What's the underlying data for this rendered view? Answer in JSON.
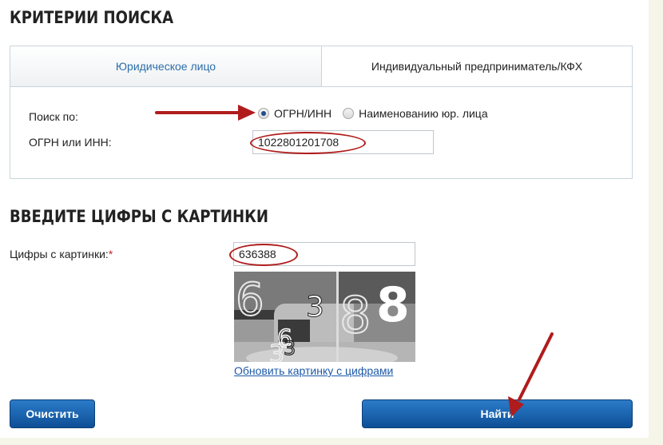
{
  "search_criteria": {
    "heading": "КРИТЕРИИ ПОИСКА",
    "tabs": [
      {
        "label": "Юридическое лицо",
        "active": true
      },
      {
        "label": "Индивидуальный предприниматель/КФХ",
        "active": false
      }
    ],
    "search_by_label": "Поиск по:",
    "radio_options": [
      {
        "label": "ОГРН/ИНН",
        "checked": true
      },
      {
        "label": "Наименованию юр. лица",
        "checked": false
      }
    ],
    "ogrn_label": "ОГРН или ИНН:",
    "ogrn_value": "1022801201708"
  },
  "captcha": {
    "heading": "ВВЕДИТЕ ЦИФРЫ С КАРТИНКИ",
    "label": "Цифры с картинки:",
    "required_mark": "*",
    "value": "636388",
    "image_digits": "636388",
    "refresh_link": "Обновить картинку с цифрами"
  },
  "buttons": {
    "clear": "Очистить",
    "search": "Найти"
  },
  "annotations": {
    "color": "#b01c1c"
  }
}
